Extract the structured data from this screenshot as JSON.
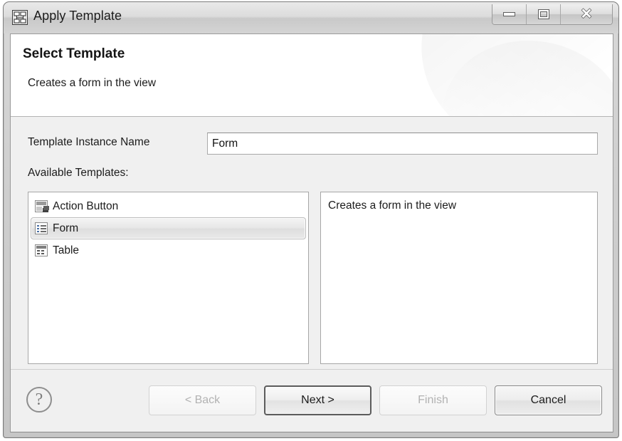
{
  "window": {
    "title": "Apply Template",
    "icon": "template-hierarchy-icon",
    "controls": {
      "minimize_label": "Minimize",
      "maximize_label": "Maximize",
      "close_label": "Close"
    }
  },
  "header": {
    "title": "Select Template",
    "subtitle": "Creates a form in the view"
  },
  "form": {
    "instance_name_label": "Template Instance Name",
    "instance_name_value": "Form",
    "instance_name_placeholder": "",
    "available_templates_label": "Available Templates:"
  },
  "templates": [
    {
      "label": "Action Button",
      "icon": "action-button-icon",
      "selected": false
    },
    {
      "label": "Form",
      "icon": "form-icon",
      "selected": true
    },
    {
      "label": "Table",
      "icon": "table-icon",
      "selected": false
    }
  ],
  "description": {
    "text": "Creates a form in the view"
  },
  "footer": {
    "help_icon": "help-question-icon",
    "help_glyph": "?",
    "buttons": [
      {
        "label": "< Back",
        "state": "disabled"
      },
      {
        "label": "Next >",
        "state": "default"
      },
      {
        "label": "Finish",
        "state": "disabled"
      },
      {
        "label": "Cancel",
        "state": "enabled"
      }
    ]
  },
  "colors": {
    "dialog_background": "#f0f0f0",
    "header_background": "#ffffff",
    "field_background": "#ffffff",
    "text": "#1c1c1c",
    "disabled_text": "#b2b2b2",
    "border": "#a6a6a6"
  }
}
